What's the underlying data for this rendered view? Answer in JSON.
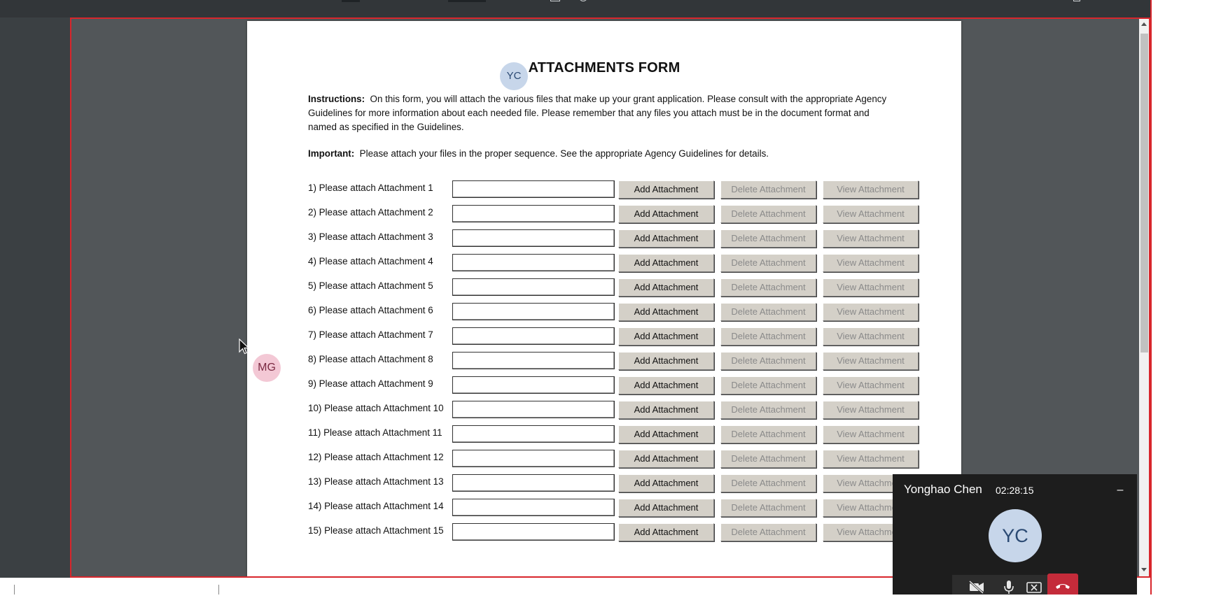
{
  "form": {
    "title": "ATTACHMENTS FORM",
    "instructions_label": "Instructions:",
    "instructions_text": "On this form, you will attach the various files that make up your grant application. Please consult with the appropriate Agency Guidelines for more information about each needed file. Please remember that any files you attach must be in the document format and named as specified in the Guidelines.",
    "important_label": "Important:",
    "important_text": "Please attach your files in the proper sequence. See the appropriate Agency Guidelines for details.",
    "add_label": "Add Attachment",
    "delete_label": "Delete Attachment",
    "view_label": "View Attachment",
    "rows": [
      "1) Please attach Attachment 1",
      "2) Please attach Attachment 2",
      "3) Please attach Attachment 3",
      "4) Please attach Attachment 4",
      "5) Please attach Attachment 5",
      "6) Please attach Attachment 6",
      "7) Please attach Attachment 7",
      "8) Please attach Attachment 8",
      "9) Please attach Attachment 9",
      "10) Please attach Attachment 10",
      "11) Please attach Attachment 11",
      "12) Please attach Attachment 12",
      "13) Please attach Attachment 13",
      "14) Please attach Attachment 14",
      "15) Please attach Attachment 15"
    ]
  },
  "participants": {
    "page_avatar_1": "YC",
    "page_avatar_2": "MG"
  },
  "call": {
    "name": "Yonghao Chen",
    "time": "02:28:15",
    "minimize_label": "–",
    "avatar": "YC",
    "controls": [
      "camera-off-icon",
      "microphone-icon",
      "screen-share-stop-icon",
      "end-call-icon"
    ]
  },
  "colors": {
    "share_border": "#d8262c",
    "end_call": "#c42b3a",
    "viewer_bg": "#525659"
  }
}
